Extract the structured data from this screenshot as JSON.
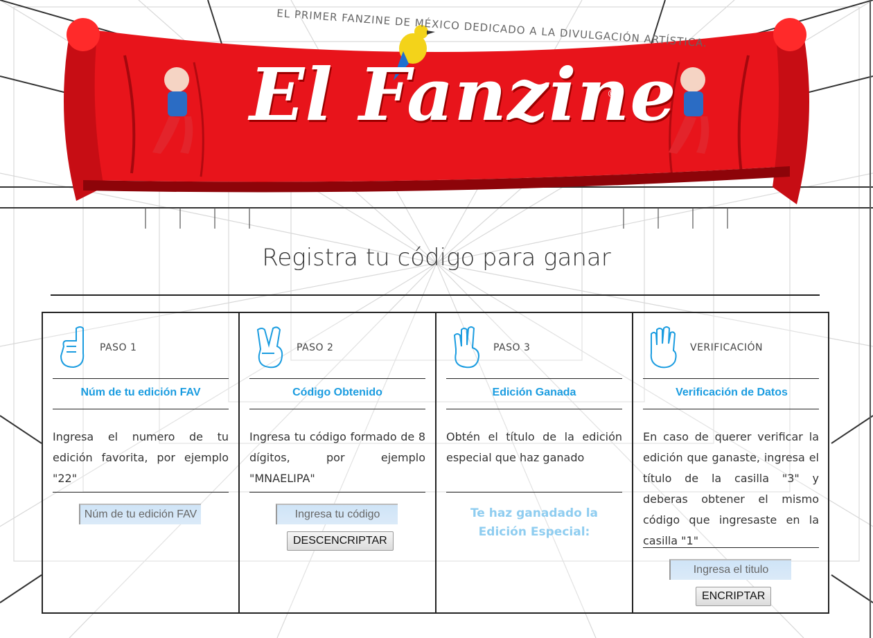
{
  "header": {
    "tagline": "EL PRIMER FANZINE DE MÉXICO DEDICADO A LA DIVULGACIÓN ARTÍSTICA.",
    "logo_text": "El Fanzine",
    "registered_mark": "®"
  },
  "page_title": "Registra tu código para ganar",
  "steps": [
    {
      "label": "PASO 1",
      "title": "Núm de tu edición FAV",
      "description": "Ingresa el numero de tu edición favorita, por ejemplo \"22\"",
      "input_placeholder": "Núm de tu edición FAV"
    },
    {
      "label": "PASO 2",
      "title": "Código Obtenido",
      "description": "Ingresa tu código formado de 8 dígitos, por ejemplo \"MNAELIPA\"",
      "input_placeholder": "Ingresa tu código",
      "button_label": "DESCENCRIPTAR"
    },
    {
      "label": "PASO 3",
      "title": "Edición Ganada",
      "description": "Obtén el título de la edición especial que haz ganado",
      "result_text": "Te haz ganadado la Edición Especial:"
    },
    {
      "label": "VERIFICACIÓN",
      "title": "Verificación de Datos",
      "description": "En caso de querer verificar la edición que ganaste, ingresa el título de la casilla \"3\" y deberas obtener el mismo código que ingresaste en la casilla \"1\"",
      "input_placeholder": "Ingresa el titulo",
      "button_label": "ENCRIPTAR"
    }
  ],
  "colors": {
    "accent": "#1a9ce0",
    "banner_red": "#e8141b",
    "result_text": "#8fcdf0"
  },
  "icons": [
    "hand-one-finger-icon",
    "hand-peace-icon",
    "hand-three-fingers-icon",
    "hand-four-fingers-icon",
    "bird-icon"
  ]
}
